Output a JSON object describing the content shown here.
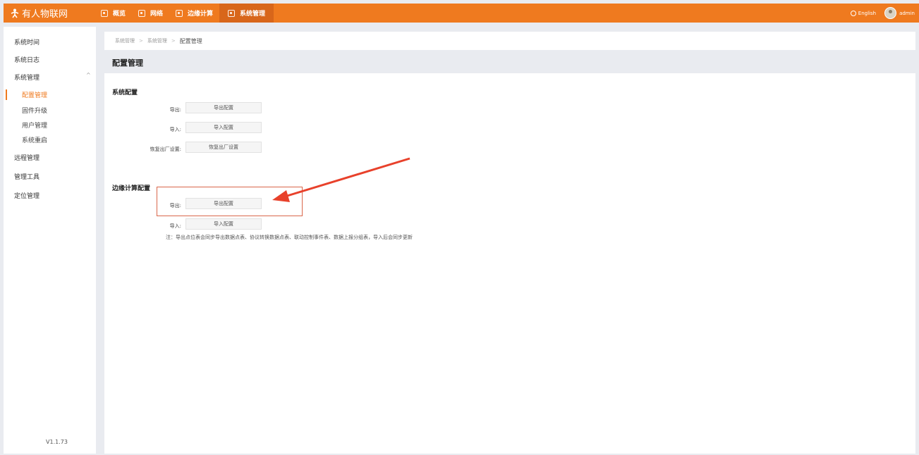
{
  "app": {
    "name": "有人物联网"
  },
  "nav": [
    {
      "label": "概览"
    },
    {
      "label": "网络"
    },
    {
      "label": "边缘计算"
    },
    {
      "label": "系统管理"
    }
  ],
  "topbar": {
    "language": "English",
    "user": "admin"
  },
  "sidebar": {
    "items": [
      {
        "label": "系统时间"
      },
      {
        "label": "系统日志"
      },
      {
        "label": "系统管理"
      },
      {
        "label": "远程管理"
      },
      {
        "label": "管理工具"
      },
      {
        "label": "定位管理"
      }
    ],
    "sub_items": [
      {
        "label": "配置管理"
      },
      {
        "label": "固件升级"
      },
      {
        "label": "用户管理"
      },
      {
        "label": "系统重启"
      }
    ],
    "version": "V1.1.73"
  },
  "breadcrumb": [
    "系统管理",
    "系统管理",
    "配置管理"
  ],
  "page_title": "配置管理",
  "system_config": {
    "title": "系统配置",
    "rows": [
      {
        "label": "导出:",
        "button": "导出配置"
      },
      {
        "label": "导入:",
        "button": "导入配置"
      },
      {
        "label": "恢复出厂设置:",
        "button": "恢复出厂设置"
      }
    ]
  },
  "edge_config": {
    "title": "边缘计算配置",
    "rows": [
      {
        "label": "导出:",
        "button": "导出配置"
      },
      {
        "label": "导入:",
        "button": "导入配置"
      }
    ],
    "note": "注：导出点位表会同步导出数据点表、协议转换数据点表、联动控制事件表、数据上报分组表，导入后会同步更新"
  },
  "colors": {
    "accent": "#ef7a1f",
    "annotation": "#e8412b"
  }
}
